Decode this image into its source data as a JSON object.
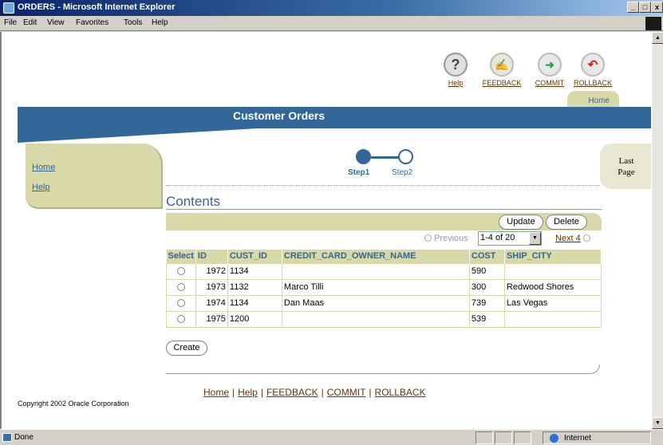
{
  "window": {
    "title": "ORDERS - Microsoft Internet Explorer",
    "min": "_",
    "max": "□",
    "close": "x"
  },
  "menu": [
    "File",
    "Edit",
    "View",
    "Favorites",
    "Tools",
    "Help"
  ],
  "global_buttons": [
    {
      "label": "Help",
      "icon": "help-icon",
      "glyph": "?",
      "color": "#ffffff"
    },
    {
      "label": "FEEDBACK",
      "icon": "feedback-icon",
      "glyph": "✍",
      "color": "#ffffff"
    },
    {
      "label": "COMMIT",
      "icon": "commit-icon",
      "glyph": "➜",
      "color": "#2e9e4f"
    },
    {
      "label": "ROLLBACK",
      "icon": "rollback-icon",
      "glyph": "↶",
      "color": "#d2221b"
    }
  ],
  "home_tab": "Home",
  "banner_title": "Customer Orders",
  "sidenav": [
    "Home",
    "Help"
  ],
  "train": {
    "step1": "Step1",
    "step2": "Step2"
  },
  "last_page": {
    "line1": "Last",
    "line2": "Page"
  },
  "contents_title": "Contents",
  "actions": {
    "update": "Update",
    "delete": "Delete",
    "create": "Create"
  },
  "pagination": {
    "previous": "Previous",
    "range": "1-4 of 20",
    "next": "Next 4"
  },
  "table": {
    "headers": [
      "Select",
      "ID",
      "CUST_ID",
      "CREDIT_CARD_OWNER_NAME",
      "COST",
      "SHIP_CITY"
    ],
    "rows": [
      {
        "id": "1972",
        "cust_id": "1134",
        "owner": "",
        "cost": "590",
        "city": ""
      },
      {
        "id": "1973",
        "cust_id": "1132",
        "owner": "Marco Tilli",
        "cost": "300",
        "city": "Redwood Shores"
      },
      {
        "id": "1974",
        "cust_id": "1134",
        "owner": "Dan Maas",
        "cost": "739",
        "city": "Las Vegas"
      },
      {
        "id": "1975",
        "cust_id": "1200",
        "owner": "",
        "cost": "539",
        "city": ""
      }
    ]
  },
  "footer_links": [
    "Home",
    "Help",
    "FEEDBACK",
    "COMMIT",
    "ROLLBACK"
  ],
  "footer_sep": "|",
  "copyright": "Copyright 2002 Oracle Corporation",
  "status": {
    "text": "Done",
    "zone": "Internet"
  }
}
